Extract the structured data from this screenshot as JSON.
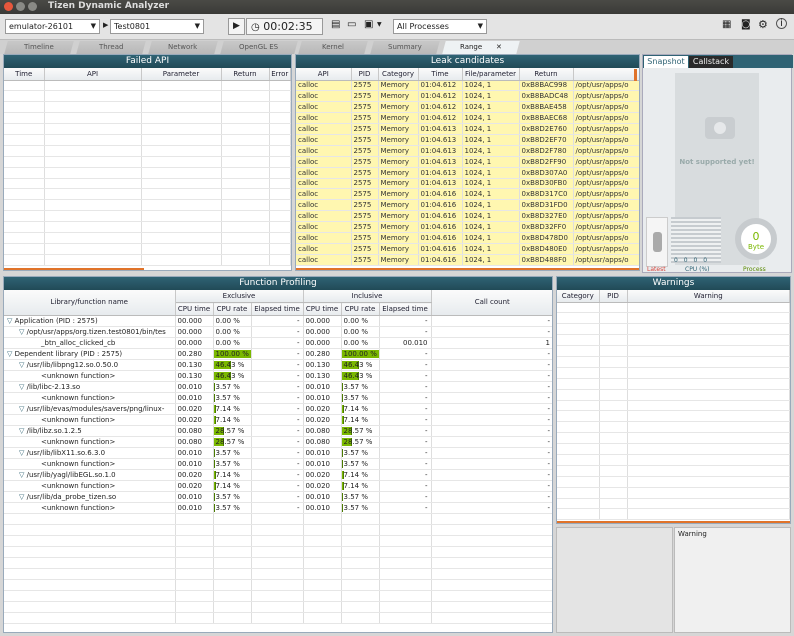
{
  "window": {
    "title": "Tizen Dynamic Analyzer"
  },
  "toolbar": {
    "device": "emulator-26101",
    "app": "Test0801",
    "timer": "00:02:35",
    "process": "All Processes"
  },
  "tabs": [
    {
      "label": "Timeline"
    },
    {
      "label": "Thread"
    },
    {
      "label": "Network"
    },
    {
      "label": "OpenGL ES"
    },
    {
      "label": "Kernel"
    },
    {
      "label": "Summary"
    },
    {
      "label": "Range"
    }
  ],
  "failed_api": {
    "title": "Failed API",
    "columns": [
      "Time",
      "API",
      "Parameter",
      "Return",
      "Error"
    ]
  },
  "leak": {
    "title": "Leak candidates",
    "columns": [
      "API",
      "PID",
      "Category",
      "Time",
      "File/parameter",
      "Return",
      ""
    ],
    "rows": [
      [
        "calloc",
        "2575",
        "Memory",
        "01:04.612",
        "1024, 1",
        "0xB8BAC998",
        "/opt/usr/apps/o"
      ],
      [
        "calloc",
        "2575",
        "Memory",
        "01:04.612",
        "1024, 1",
        "0xB8BADC48",
        "/opt/usr/apps/o"
      ],
      [
        "calloc",
        "2575",
        "Memory",
        "01:04.612",
        "1024, 1",
        "0xB8BAE458",
        "/opt/usr/apps/o"
      ],
      [
        "calloc",
        "2575",
        "Memory",
        "01:04.612",
        "1024, 1",
        "0xB8BAEC68",
        "/opt/usr/apps/o"
      ],
      [
        "calloc",
        "2575",
        "Memory",
        "01:04.613",
        "1024, 1",
        "0xB8D2E760",
        "/opt/usr/apps/o"
      ],
      [
        "calloc",
        "2575",
        "Memory",
        "01:04.613",
        "1024, 1",
        "0xB8D2EF70",
        "/opt/usr/apps/o"
      ],
      [
        "calloc",
        "2575",
        "Memory",
        "01:04.613",
        "1024, 1",
        "0xB8D2F780",
        "/opt/usr/apps/o"
      ],
      [
        "calloc",
        "2575",
        "Memory",
        "01:04.613",
        "1024, 1",
        "0xB8D2FF90",
        "/opt/usr/apps/o"
      ],
      [
        "calloc",
        "2575",
        "Memory",
        "01:04.613",
        "1024, 1",
        "0xB8D307A0",
        "/opt/usr/apps/o"
      ],
      [
        "calloc",
        "2575",
        "Memory",
        "01:04.613",
        "1024, 1",
        "0xB8D30FB0",
        "/opt/usr/apps/o"
      ],
      [
        "calloc",
        "2575",
        "Memory",
        "01:04.616",
        "1024, 1",
        "0xB8D317C0",
        "/opt/usr/apps/o"
      ],
      [
        "calloc",
        "2575",
        "Memory",
        "01:04.616",
        "1024, 1",
        "0xB8D31FD0",
        "/opt/usr/apps/o"
      ],
      [
        "calloc",
        "2575",
        "Memory",
        "01:04.616",
        "1024, 1",
        "0xB8D327E0",
        "/opt/usr/apps/o"
      ],
      [
        "calloc",
        "2575",
        "Memory",
        "01:04.616",
        "1024, 1",
        "0xB8D32FF0",
        "/opt/usr/apps/o"
      ],
      [
        "calloc",
        "2575",
        "Memory",
        "01:04.616",
        "1024, 1",
        "0xB8D478D0",
        "/opt/usr/apps/o"
      ],
      [
        "calloc",
        "2575",
        "Memory",
        "01:04.616",
        "1024, 1",
        "0xB8D480E0",
        "/opt/usr/apps/o"
      ],
      [
        "calloc",
        "2575",
        "Memory",
        "01:04.616",
        "1024, 1",
        "0xB8D488F0",
        "/opt/usr/apps/o"
      ]
    ]
  },
  "snapshot": {
    "tab1": "Snapshot",
    "tab2": "Callstack",
    "not_supported": "Not supported yet!",
    "latest": "Latest",
    "cpu_label": "CPU (%)",
    "cpu_values": [
      "0",
      "0",
      "0",
      "0"
    ],
    "process_label": "Process",
    "gauge_value": "0",
    "gauge_unit": "Byte"
  },
  "function_profiling": {
    "title": "Function Profiling",
    "col_name": "Library/function name",
    "exclusive": "Exclusive",
    "inclusive": "Inclusive",
    "call_count": "Call count",
    "sub": [
      "CPU time",
      "CPU rate",
      "Elapsed time"
    ],
    "rows": [
      {
        "name": "Application (PID : 2575)",
        "indent": 0,
        "tree": true,
        "ex_time": "00.000",
        "ex_rate": "0.00 %",
        "rate": 0,
        "ex_el": "-",
        "in_time": "00.000",
        "in_rate": "0.00 %",
        "in_el": "-",
        "calls": "-"
      },
      {
        "name": "/opt/usr/apps/org.tizen.test0801/bin/tes",
        "indent": 1,
        "tree": true,
        "ex_time": "00.000",
        "ex_rate": "0.00 %",
        "rate": 0,
        "ex_el": "-",
        "in_time": "00.000",
        "in_rate": "0.00 %",
        "in_el": "-",
        "calls": "-"
      },
      {
        "name": "_btn_alloc_clicked_cb",
        "indent": 2,
        "tree": false,
        "ex_time": "00.000",
        "ex_rate": "0.00 %",
        "rate": 0,
        "ex_el": "-",
        "in_time": "00.000",
        "in_rate": "0.00 %",
        "in_el": "00.010",
        "calls": "1"
      },
      {
        "name": "Dependent library (PID : 2575)",
        "indent": 0,
        "tree": true,
        "ex_time": "00.280",
        "ex_rate": "100.00 %",
        "rate": 100,
        "ex_el": "-",
        "in_time": "00.280",
        "in_rate": "100.00 %",
        "in_el": "-",
        "calls": "-"
      },
      {
        "name": "/usr/lib/libpng12.so.0.50.0",
        "indent": 1,
        "tree": true,
        "ex_time": "00.130",
        "ex_rate": "46.43 %",
        "rate": 46.43,
        "ex_el": "-",
        "in_time": "00.130",
        "in_rate": "46.43 %",
        "in_el": "-",
        "calls": "-"
      },
      {
        "name": "<unknown function>",
        "indent": 2,
        "tree": false,
        "ex_time": "00.130",
        "ex_rate": "46.43 %",
        "rate": 46.43,
        "ex_el": "-",
        "in_time": "00.130",
        "in_rate": "46.43 %",
        "in_el": "-",
        "calls": "-"
      },
      {
        "name": "/lib/libc-2.13.so",
        "indent": 1,
        "tree": true,
        "ex_time": "00.010",
        "ex_rate": "3.57 %",
        "rate": 3.57,
        "ex_el": "-",
        "in_time": "00.010",
        "in_rate": "3.57 %",
        "in_el": "-",
        "calls": "-"
      },
      {
        "name": "<unknown function>",
        "indent": 2,
        "tree": false,
        "ex_time": "00.010",
        "ex_rate": "3.57 %",
        "rate": 3.57,
        "ex_el": "-",
        "in_time": "00.010",
        "in_rate": "3.57 %",
        "in_el": "-",
        "calls": "-"
      },
      {
        "name": "/usr/lib/evas/modules/savers/png/linux-",
        "indent": 1,
        "tree": true,
        "ex_time": "00.020",
        "ex_rate": "7.14 %",
        "rate": 7.14,
        "ex_el": "-",
        "in_time": "00.020",
        "in_rate": "7.14 %",
        "in_el": "-",
        "calls": "-"
      },
      {
        "name": "<unknown function>",
        "indent": 2,
        "tree": false,
        "ex_time": "00.020",
        "ex_rate": "7.14 %",
        "rate": 7.14,
        "ex_el": "-",
        "in_time": "00.020",
        "in_rate": "7.14 %",
        "in_el": "-",
        "calls": "-"
      },
      {
        "name": "/lib/libz.so.1.2.5",
        "indent": 1,
        "tree": true,
        "ex_time": "00.080",
        "ex_rate": "28.57 %",
        "rate": 28.57,
        "ex_el": "-",
        "in_time": "00.080",
        "in_rate": "28.57 %",
        "in_el": "-",
        "calls": "-"
      },
      {
        "name": "<unknown function>",
        "indent": 2,
        "tree": false,
        "ex_time": "00.080",
        "ex_rate": "28.57 %",
        "rate": 28.57,
        "ex_el": "-",
        "in_time": "00.080",
        "in_rate": "28.57 %",
        "in_el": "-",
        "calls": "-"
      },
      {
        "name": "/usr/lib/libX11.so.6.3.0",
        "indent": 1,
        "tree": true,
        "ex_time": "00.010",
        "ex_rate": "3.57 %",
        "rate": 3.57,
        "ex_el": "-",
        "in_time": "00.010",
        "in_rate": "3.57 %",
        "in_el": "-",
        "calls": "-"
      },
      {
        "name": "<unknown function>",
        "indent": 2,
        "tree": false,
        "ex_time": "00.010",
        "ex_rate": "3.57 %",
        "rate": 3.57,
        "ex_el": "-",
        "in_time": "00.010",
        "in_rate": "3.57 %",
        "in_el": "-",
        "calls": "-"
      },
      {
        "name": "/usr/lib/yagl/libEGL.so.1.0",
        "indent": 1,
        "tree": true,
        "ex_time": "00.020",
        "ex_rate": "7.14 %",
        "rate": 7.14,
        "ex_el": "-",
        "in_time": "00.020",
        "in_rate": "7.14 %",
        "in_el": "-",
        "calls": "-"
      },
      {
        "name": "<unknown function>",
        "indent": 2,
        "tree": false,
        "ex_time": "00.020",
        "ex_rate": "7.14 %",
        "rate": 7.14,
        "ex_el": "-",
        "in_time": "00.020",
        "in_rate": "7.14 %",
        "in_el": "-",
        "calls": "-"
      },
      {
        "name": "/usr/lib/da_probe_tizen.so",
        "indent": 1,
        "tree": true,
        "ex_time": "00.010",
        "ex_rate": "3.57 %",
        "rate": 3.57,
        "ex_el": "-",
        "in_time": "00.010",
        "in_rate": "3.57 %",
        "in_el": "-",
        "calls": "-"
      },
      {
        "name": "<unknown function>",
        "indent": 2,
        "tree": false,
        "ex_time": "00.010",
        "ex_rate": "3.57 %",
        "rate": 3.57,
        "ex_el": "-",
        "in_time": "00.010",
        "in_rate": "3.57 %",
        "in_el": "-",
        "calls": "-"
      }
    ]
  },
  "warnings": {
    "title": "Warnings",
    "columns": [
      "Category",
      "PID",
      "Warning"
    ],
    "detail_label": "Warning"
  },
  "colors": {
    "title_bar": "#2f6374",
    "bar": "#7ab800",
    "leak_row": "#fff7b0",
    "accent": "#e0732a"
  }
}
